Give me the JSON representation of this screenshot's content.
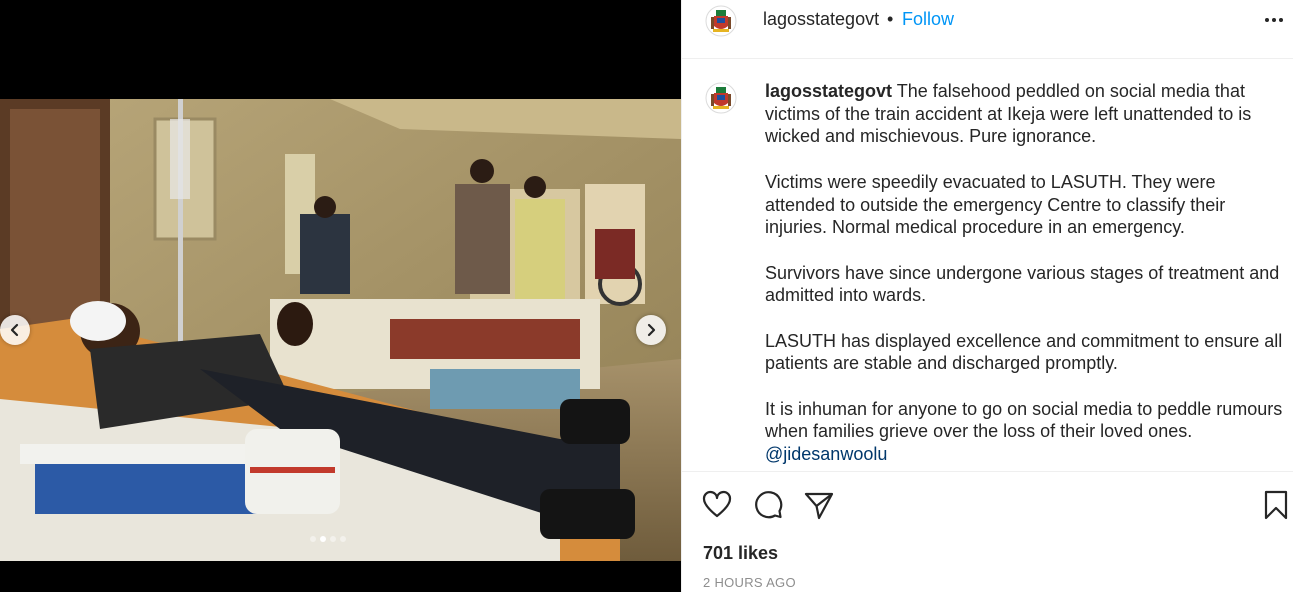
{
  "post": {
    "username": "lagosstategovt",
    "separator": "•",
    "follow_label": "Follow",
    "caption": {
      "username": "lagosstategovt",
      "paragraphs": [
        "The falsehood peddled on social media that victims of the train accident at Ikeja were left unattended to is wicked and mischievous. Pure ignorance.",
        "Victims were speedily evacuated to LASUTH. They were attended to outside the emergency Centre to classify their injuries. Normal medical procedure in an emergency.",
        "Survivors have since undergone various stages of treatment and admitted into wards.",
        "LASUTH has displayed excellence and commitment to ensure all patients are stable and discharged promptly.",
        "It is inhuman for anyone to go on social media to peddle rumours when families grieve over the loss of their loved ones."
      ],
      "mention": "@jidesanwoolu"
    },
    "likes": "701 likes",
    "timestamp": "2 HOURS AGO"
  },
  "carousel": {
    "slide_count": 4,
    "active_slide": 2
  },
  "icons": {
    "more": "more-options-icon",
    "like": "heart-icon",
    "comment": "comment-bubble-icon",
    "share": "paper-plane-icon",
    "save": "bookmark-icon",
    "prev": "chevron-left-icon",
    "next": "chevron-right-icon"
  },
  "colors": {
    "accent": "#0095f6",
    "text": "#262626",
    "muted": "#8e8e8e",
    "mention": "#00376b"
  }
}
